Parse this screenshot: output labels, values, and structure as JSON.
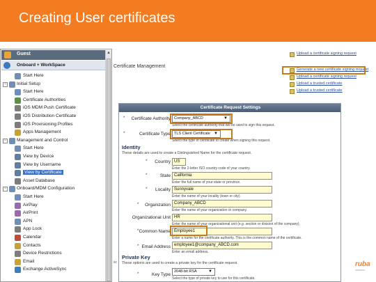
{
  "slide": {
    "title": "Creating User certificates"
  },
  "nav": {
    "guest": "Guest",
    "onboard": "Onboard + WorkSpace",
    "items": [
      {
        "label": "Start Here",
        "group": false,
        "active": false,
        "color": "#6f8fb8"
      },
      {
        "label": "Initial Setup",
        "group": true,
        "toggle": "−",
        "active": false,
        "color": "#6f8fb8"
      },
      {
        "label": "Start Here",
        "group": false,
        "active": false,
        "color": "#6f8fb8"
      },
      {
        "label": "Certificate Authorities",
        "group": false,
        "active": false,
        "color": "#5b8f4a"
      },
      {
        "label": "iOS MDM Push Certificate",
        "group": false,
        "active": false,
        "color": "#7d7d7d"
      },
      {
        "label": "iOS Distribution Certificate",
        "group": false,
        "active": false,
        "color": "#7d7d7d"
      },
      {
        "label": "iOS Provisioning Profiles",
        "group": false,
        "active": false,
        "color": "#7d7d7d"
      },
      {
        "label": "Apps Management",
        "group": false,
        "active": false,
        "color": "#c7a236"
      },
      {
        "label": "Management and Control",
        "group": true,
        "toggle": "−",
        "active": false,
        "color": "#6f8fb8"
      },
      {
        "label": "Start Here",
        "group": false,
        "active": false,
        "color": "#6f8fb8"
      },
      {
        "label": "View by Device",
        "group": false,
        "active": false,
        "color": "#5f7f9f"
      },
      {
        "label": "View by Username",
        "group": false,
        "active": false,
        "color": "#5f7f9f"
      },
      {
        "label": "View by Certificate",
        "group": false,
        "active": true,
        "color": "#5f7f9f"
      },
      {
        "label": "Asset Database",
        "group": false,
        "active": false,
        "color": "#7d7d7d"
      },
      {
        "label": "Onboard/MDM Configuration",
        "group": true,
        "toggle": "−",
        "active": false,
        "color": "#6f8fb8"
      },
      {
        "label": "Start Here",
        "group": false,
        "active": false,
        "color": "#6f8fb8"
      },
      {
        "label": "AirPlay",
        "group": false,
        "active": false,
        "color": "#9a6ab0"
      },
      {
        "label": "AirPrint",
        "group": false,
        "active": false,
        "color": "#9a6ab0"
      },
      {
        "label": "APN",
        "group": false,
        "active": false,
        "color": "#6f8fb8"
      },
      {
        "label": "App Lock",
        "group": false,
        "active": false,
        "color": "#7d7d7d"
      },
      {
        "label": "Calendar",
        "group": false,
        "active": false,
        "color": "#c44b3a"
      },
      {
        "label": "Contacts",
        "group": false,
        "active": false,
        "color": "#c7a236"
      },
      {
        "label": "Device Restrictions",
        "group": false,
        "active": false,
        "color": "#7d7d7d"
      },
      {
        "label": "Email",
        "group": false,
        "active": false,
        "color": "#c7a236"
      },
      {
        "label": "Exchange ActiveSync",
        "group": false,
        "active": false,
        "color": "#3a7fc4"
      }
    ]
  },
  "breadcrumb": "Certificate Management",
  "links": [
    "Upload a certificate signing request",
    "Generate a new certificate signing request",
    "Upload a certificate signing request",
    "Upload a trusted certificate",
    "Upload a trusted certificate"
  ],
  "form": {
    "title": "Certificate Request Settings",
    "ca_label": "Certificate Authority",
    "ca_value": "Company_ABCD",
    "ca_hint": "Select the certificate authority that will be used to sign this request.",
    "type_label": "Certificate Type",
    "type_value": "TLS Client Certificate",
    "type_hint": "Select the type of certificate to create when signing this request.",
    "identity_title": "Identity",
    "identity_desc": "These details are used to create a Distinguished Name for the certificate request.",
    "country_label": "Country",
    "country_value": "US",
    "country_hint": "Enter the 2-letter ISO country code of your country.",
    "state_label": "State",
    "state_value": "California",
    "state_hint": "Enter the full name of your state or province.",
    "locality_label": "Locality",
    "locality_value": "Sunnyvale",
    "locality_hint": "Enter the name of your locality (town or city).",
    "org_label": "Organization",
    "org_value": "Company_ABCD",
    "org_hint": "Enter the name of your organization or company.",
    "ou_label": "Organizational Unit",
    "ou_value": "HR",
    "ou_hint": "Enter the name of your organizational unit (e.g. section or division of the company).",
    "cn_label": "Common Name",
    "cn_value": "Employee1",
    "cn_hint": "Enter a name for the certificate authority. This is the common name of the certificate.",
    "email_label": "Email Address",
    "email_value": "employee1@company_ABCD.com",
    "email_hint": "Enter an email address.",
    "pk_title": "Private Key",
    "pk_desc": "These options are used to create a private key for the certificate request.",
    "keytype_label": "Key Type",
    "keytype_value": "2048-bit RSA",
    "keytype_hint": "Select the type of private key to use for this certificate."
  },
  "brand": {
    "logo": "ruba",
    "sub": "networks"
  },
  "left_edge": "sc"
}
